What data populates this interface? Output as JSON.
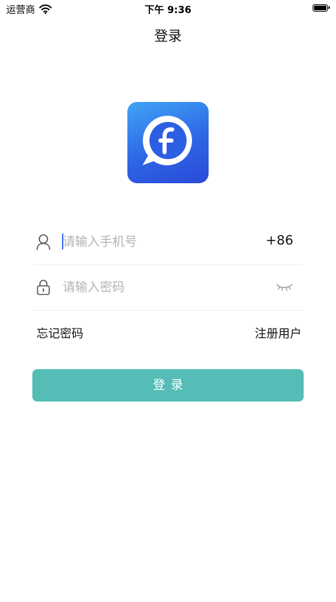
{
  "status_bar": {
    "carrier": "运营商",
    "time": "下午 9:36"
  },
  "header": {
    "title": "登录"
  },
  "app": {
    "logo_letter": "f",
    "brand_color": "#2d66e6"
  },
  "form": {
    "phone_placeholder": "请输入手机号",
    "phone_value": "",
    "country_code": "+86",
    "password_placeholder": "请输入密码",
    "password_value": ""
  },
  "links": {
    "forgot": "忘记密码",
    "register": "注册用户"
  },
  "login_button": {
    "label": "登录",
    "color": "#55bdb6"
  },
  "icons": [
    "wifi-icon",
    "battery-icon",
    "user-icon",
    "lock-icon",
    "eye-closed-icon"
  ]
}
